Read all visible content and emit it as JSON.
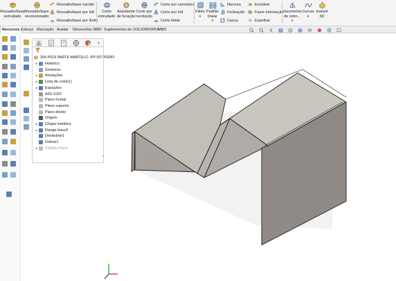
{
  "ribbon": {
    "extrude_boss": "Ressalto/base extrudado",
    "revolve_boss": "Ressalto/base revolucionado",
    "swept_boss": "Ressalto/base varrido",
    "loft_boss": "Ressalto/base por loft",
    "boundary_boss": "Ressalto/base por limite",
    "extruded_cut": "Corte extrudado",
    "hole_wizard": "Assistente de furação",
    "revolved_cut": "Corte por revolução",
    "swept_cut": "Corte por varredura",
    "lofted_cut": "Corte por loft",
    "boundary_cut": "Corte limite",
    "fillet": "Filete",
    "linear_pattern": "Padrão linear",
    "rib": "Nervura",
    "draft": "Inclinação",
    "shell": "Casca",
    "wrap": "Envolver",
    "intersect": "Fazer interseção",
    "mirror": "Espelhar",
    "ref_geometry": "Geometria de refer...",
    "curves": "Curvas",
    "instant3d": "Instant 3D"
  },
  "tabs": [
    "Recursos",
    "Esboço",
    "Marcação",
    "Avaliar",
    "Dimensões MBD",
    "Suplementos do SOLIDWORKS",
    "MBD"
  ],
  "tree": {
    "part_name": "354 P019 PARTE MARTELO -PP 007 PERFI",
    "items": [
      {
        "label": "Histórico",
        "arrow": "▸",
        "color": "#6a8fb8"
      },
      {
        "label": "Sensores",
        "arrow": "",
        "color": "#7aa0c8"
      },
      {
        "label": "Anotações",
        "arrow": "▸",
        "color": "#c89a3a"
      },
      {
        "label": "Lista de corte(1)",
        "arrow": "▸",
        "color": "#5a8a5a"
      },
      {
        "label": "Equações",
        "arrow": "▸",
        "color": "#4a7ab0"
      },
      {
        "label": "AISI 1020",
        "arrow": "",
        "color": "#9a9a9a"
      },
      {
        "label": "Plano frontal",
        "arrow": "",
        "color": "#b8b8b8"
      },
      {
        "label": "Plano superior",
        "arrow": "",
        "color": "#b8b8b8"
      },
      {
        "label": "Plano direito",
        "arrow": "",
        "color": "#b8b8b8"
      },
      {
        "label": "Origem",
        "arrow": "",
        "color": "#555555"
      },
      {
        "label": "Chapa metálica",
        "arrow": "▸",
        "color": "#5a7fa8"
      },
      {
        "label": "Flange-base3",
        "arrow": "▸",
        "color": "#5a7fa8"
      },
      {
        "label": "Desdobrar1",
        "arrow": "",
        "color": "#5a7fa8"
      },
      {
        "label": "Dobrar1",
        "arrow": "",
        "color": "#5a7fa8"
      },
      {
        "label": "Padrão-Plano",
        "arrow": "▸",
        "color": "#bcbcbc",
        "dim": true
      }
    ]
  },
  "colors": {
    "model_top": "#bdb8b2",
    "model_side": "#8f8a86",
    "model_edge": "#1a1a1a",
    "axis_x": "#d42020",
    "axis_y": "#20a020",
    "axis_z": "#2040d0"
  }
}
